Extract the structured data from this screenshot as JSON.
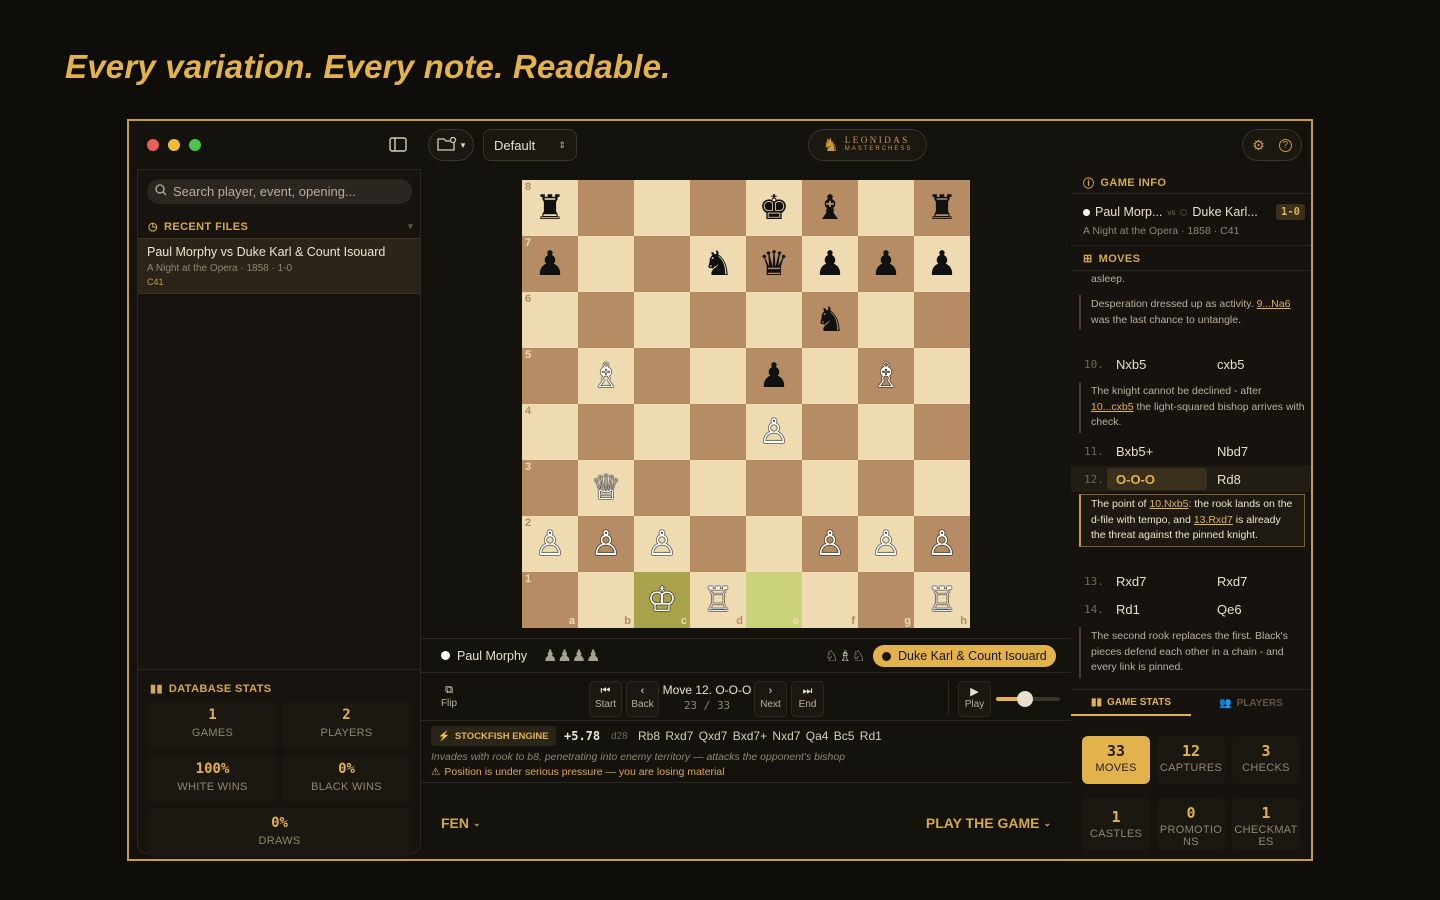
{
  "headline": "Every variation. Every note. Readable.",
  "toolbar": {
    "layout_preset": "Default",
    "logo_title": "LEONIDAS",
    "logo_subtitle": "MASTERCHESS"
  },
  "sidebar": {
    "search_placeholder": "Search player, event, opening...",
    "recent_title": "RECENT FILES",
    "recent_files": [
      {
        "title": "Paul Morphy vs Duke Karl & Count Isouard",
        "meta": "A Night at the Opera · 1858 · 1-0",
        "eco": "C41"
      }
    ],
    "stats_title": "DATABASE STATS",
    "stats": [
      {
        "value": "1",
        "label": "GAMES"
      },
      {
        "value": "2",
        "label": "PLAYERS"
      },
      {
        "value": "100%",
        "label": "WHITE WINS"
      },
      {
        "value": "0%",
        "label": "BLACK WINS"
      },
      {
        "value": "0%",
        "label": "DRAWS"
      }
    ]
  },
  "board": {
    "ranks": [
      "8",
      "7",
      "6",
      "5",
      "4",
      "3",
      "2",
      "1"
    ],
    "files": [
      "a",
      "b",
      "c",
      "d",
      "e",
      "f",
      "g",
      "h"
    ],
    "position": [
      [
        "r",
        "",
        "",
        "",
        "k",
        "b",
        "",
        "r"
      ],
      [
        "p",
        "",
        "",
        "n",
        "q",
        "p",
        "p",
        "p"
      ],
      [
        "",
        "",
        "",
        "",
        "",
        "n",
        "",
        ""
      ],
      [
        "",
        "B",
        "",
        "",
        "p",
        "",
        "B",
        ""
      ],
      [
        "",
        "",
        "",
        "",
        "P",
        "",
        "",
        ""
      ],
      [
        "",
        "Q",
        "",
        "",
        "",
        "",
        "",
        ""
      ],
      [
        "P",
        "P",
        "P",
        "",
        "",
        "P",
        "P",
        "P"
      ],
      [
        "",
        "",
        "K",
        "R",
        "",
        "",
        "",
        "R"
      ]
    ]
  },
  "players": {
    "white": "Paul Morphy",
    "white_captured": "♟♟♟♟",
    "black": "Duke Karl & Count Isouard",
    "black_captured": "♘♗♘"
  },
  "controls": {
    "flip": "Flip",
    "start": "Start",
    "back": "Back",
    "move_title": "Move 12. O-O-O",
    "move_index": "23",
    "move_total": "33",
    "next": "Next",
    "end": "End",
    "play": "Play",
    "speed_level": 0.45
  },
  "engine": {
    "label": "STOCKFISH ENGINE",
    "eval": "+5.78",
    "depth": "d28",
    "line": "Rb8 Rxd7 Qxd7 Bxd7+ Nxd7 Qa4 Bc5 Rd1",
    "description": "Invades with rook to b8, penetrating into enemy territory — attacks the opponent's bishop",
    "warning": "Position is under serious pressure — you are losing material"
  },
  "bottom": {
    "fen_label": "FEN",
    "play_label": "PLAY THE GAME"
  },
  "game_info": {
    "title": "GAME INFO",
    "white": "Paul Morp...",
    "vs": "vs",
    "black": "Duke Karl...",
    "result": "1-0",
    "meta": "A Night at the Opera · 1858 · C41"
  },
  "moves_panel": {
    "title": "MOVES",
    "top_note": "asleep.",
    "note1": {
      "pre": "Desperation dressed up as activity.",
      "link": "9...Na6",
      "post": "was the last chance to untangle."
    },
    "move10": {
      "n": "10.",
      "w": "Nxb5",
      "b": "cxb5"
    },
    "note2": {
      "pre": "The knight cannot be declined - after",
      "link": "10...cxb5",
      "post": "the light-squared bishop arrives with check."
    },
    "move11": {
      "n": "11.",
      "w": "Bxb5+",
      "b": "Nbd7"
    },
    "move12": {
      "n": "12.",
      "w": "O-O-O",
      "b": "Rd8"
    },
    "note3": {
      "pre": "The point of",
      "link": "10.Nxb5",
      "mid": ": the rook lands on the d-file with tempo, and",
      "link2": "13.Rxd7",
      "post": "is already the threat against the pinned knight."
    },
    "move13": {
      "n": "13.",
      "w": "Rxd7",
      "b": "Rxd7"
    },
    "move14": {
      "n": "14.",
      "w": "Rd1",
      "b": "Qe6"
    },
    "note4": "The second rook replaces the first. Black's pieces defend each other in a chain - and every link is pinned."
  },
  "stats_panel": {
    "tab_game": "GAME STATS",
    "tab_players": "PLAYERS",
    "items": [
      {
        "value": "33",
        "label": "MOVES"
      },
      {
        "value": "12",
        "label": "CAPTURES"
      },
      {
        "value": "3",
        "label": "CHECKS"
      },
      {
        "value": "1",
        "label": "CASTLES"
      },
      {
        "value": "0",
        "label": "PROMOTIONS"
      },
      {
        "value": "1",
        "label": "CHECKMATES"
      }
    ]
  },
  "colors": {
    "accent": "#e2b34c",
    "light_square": "#efdbb1",
    "dark_square": "#b58c63"
  }
}
